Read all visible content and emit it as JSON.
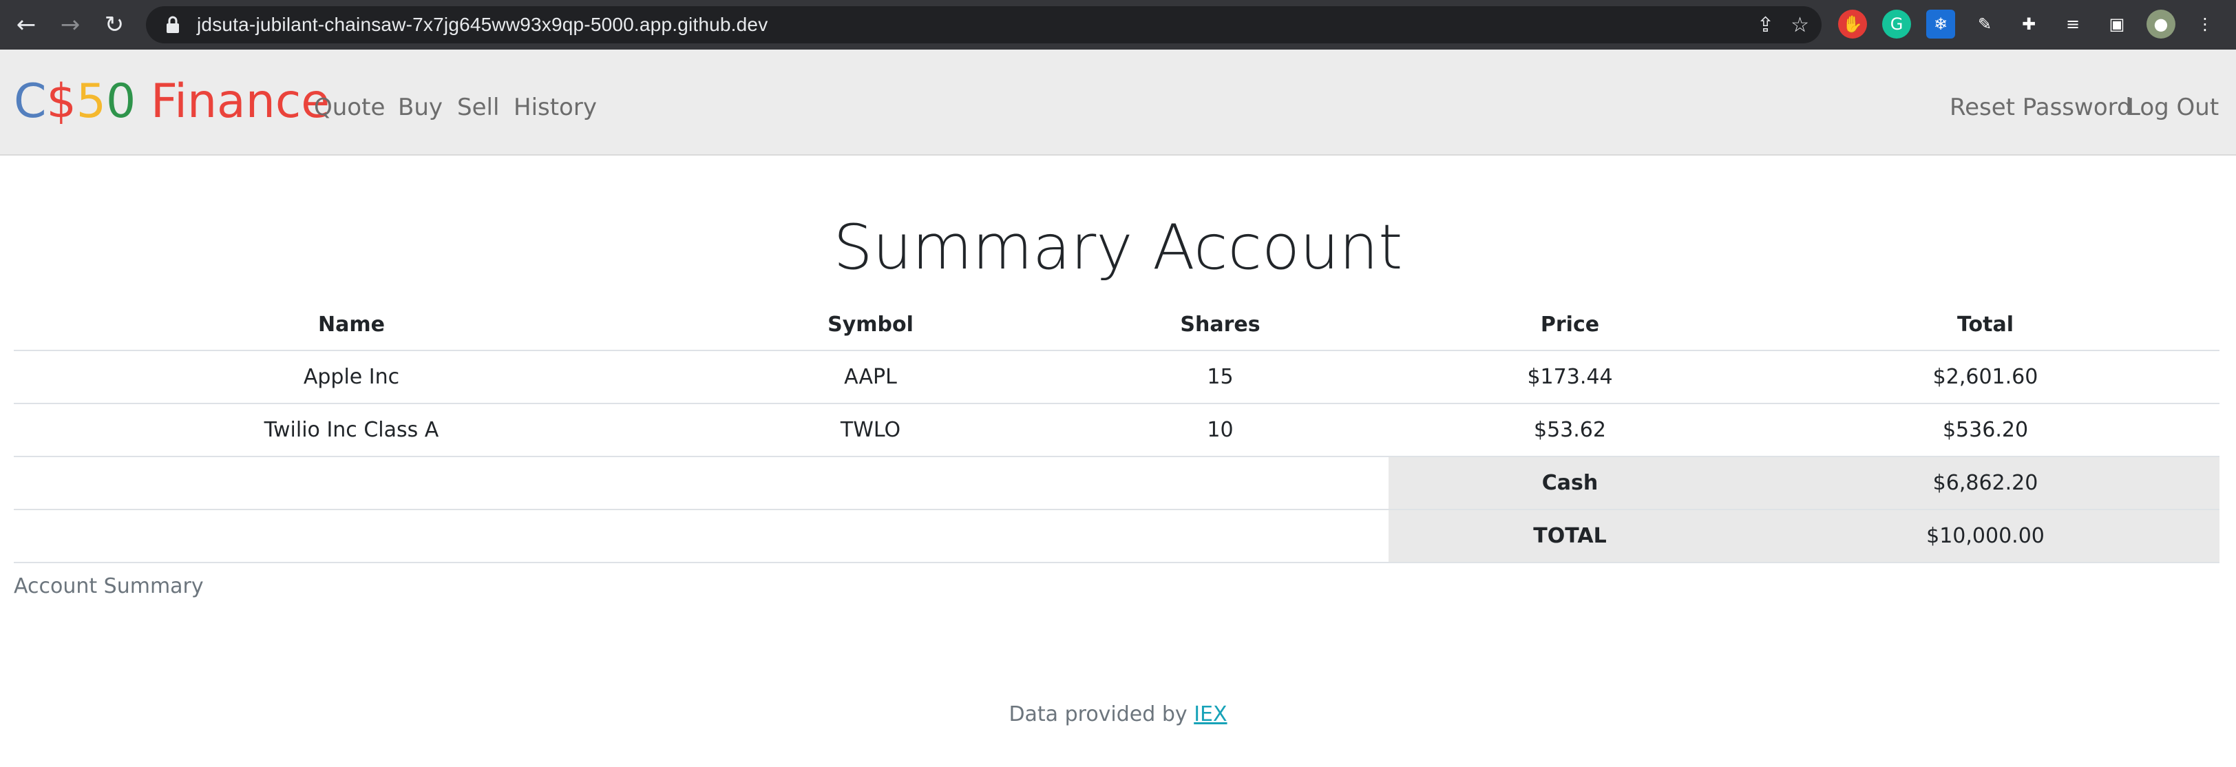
{
  "browser": {
    "url": "jdsuta-jubilant-chainsaw-7x7jg645ww93x9qp-5000.app.github.dev"
  },
  "app": {
    "brand": {
      "part1": "C",
      "part2": "$",
      "part3": "5",
      "part4": "0",
      "part5": " Finance"
    },
    "nav_left": [
      "Quote",
      "Buy",
      "Sell",
      "History"
    ],
    "nav_right": [
      "Reset Password",
      "Log Out"
    ]
  },
  "main": {
    "title": "Summary Account",
    "table": {
      "headers": [
        "Name",
        "Symbol",
        "Shares",
        "Price",
        "Total"
      ],
      "rows": [
        [
          "Apple Inc",
          "AAPL",
          "15",
          "$173.44",
          "$2,601.60"
        ],
        [
          "Twilio Inc Class A",
          "TWLO",
          "10",
          "$53.62",
          "$536.20"
        ]
      ],
      "cash_label": "Cash",
      "cash_value": "$6,862.20",
      "total_label": "TOTAL",
      "total_value": "$10,000.00"
    },
    "caption": "Account Summary"
  },
  "footer": {
    "text": "Data provided by ",
    "link": "IEX"
  }
}
